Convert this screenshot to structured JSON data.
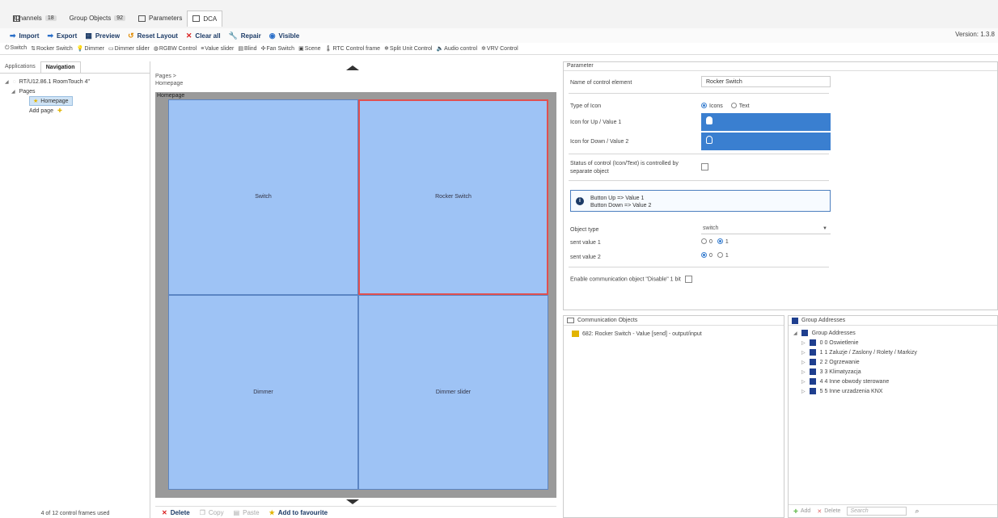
{
  "tabs": [
    {
      "label": "Channels",
      "count": "18"
    },
    {
      "label": "Group Objects",
      "count": "92"
    },
    {
      "label": "Parameters",
      "count": ""
    },
    {
      "label": "DCA",
      "count": ""
    }
  ],
  "toolbar": {
    "import": "Import",
    "export": "Export",
    "preview": "Preview",
    "reset_layout": "Reset Layout",
    "clear_all": "Clear all",
    "repair": "Repair",
    "visible": "Visible",
    "version": "Version: 1.3.8"
  },
  "controls": [
    "Switch",
    "Rocker Switch",
    "Dimmer",
    "Dimmer slider",
    "RGBW Control",
    "Value slider",
    "Blind",
    "Fan Switch",
    "Scene",
    "RTC Control frame",
    "Split Unit Control",
    "Audio control",
    "VRV Control"
  ],
  "left": {
    "tab_applications": "Applications",
    "tab_navigation": "Navigation",
    "device": "RT/U12.86.1 RoomTouch 4\"",
    "pages": "Pages",
    "homepage": "Homepage",
    "add_page": "Add page",
    "footer": "4 of 12 control frames used"
  },
  "center": {
    "crumb_pages": "Pages >",
    "crumb_home": "Homepage",
    "canvas_label": "Homepage",
    "cells": [
      "Switch",
      "Rocker Switch",
      "Dimmer",
      "Dimmer slider"
    ],
    "delete": "Delete",
    "copy": "Copy",
    "paste": "Paste",
    "favourite": "Add to favourite"
  },
  "parameter": {
    "title": "Parameter",
    "name_label": "Name of control element",
    "name_value": "Rocker Switch",
    "type_icon_label": "Type of Icon",
    "opt_icons": "Icons",
    "opt_text": "Text",
    "icon_up_label": "Icon for Up / Value 1",
    "icon_down_label": "Icon for Down / Value 2",
    "status_label_1": "Status of control (Icon/Text) is controlled by",
    "status_label_2": "separate object",
    "info_line1": "Button Up => Value 1",
    "info_line2": "Button Down => Value 2",
    "object_type_label": "Object type",
    "object_type_value": "switch",
    "sent1_label": "sent value 1",
    "sent2_label": "sent value 2",
    "opt_0": "0",
    "opt_1": "1",
    "enable_label": "Enable communication object \"Disable\" 1 bit"
  },
  "comm": {
    "title": "Communication Objects",
    "item": "682: Rocker Switch - Value [send] - output/input"
  },
  "ga": {
    "title": "Group Addresses",
    "root": "Group Addresses",
    "items": [
      "0 0 Oswietlenie",
      "1 1 Zaluzje / Zaslony / Rolety / Markizy",
      "2 2 Ogrzewanie",
      "3 3 Klimatyzacja",
      "4 4 Inne obwody sterowane",
      "5 5 Inne urzadzenia KNX"
    ],
    "add": "Add",
    "delete": "Delete",
    "search_placeholder": "Search"
  }
}
